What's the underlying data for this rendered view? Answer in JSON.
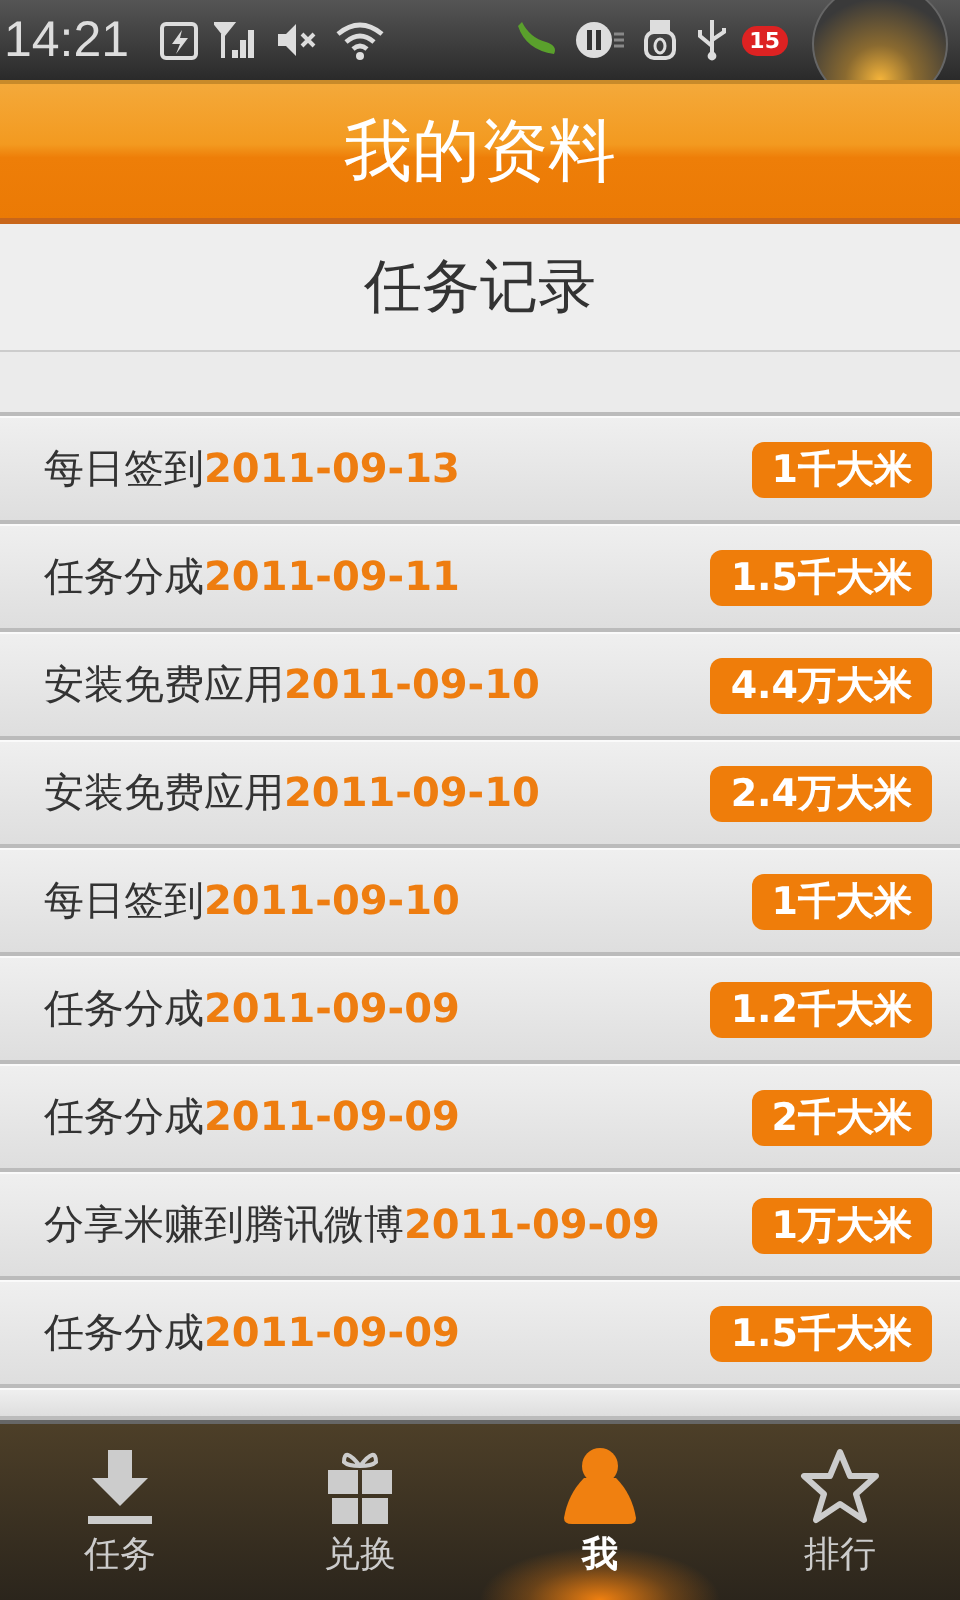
{
  "status_bar": {
    "time": "14:21",
    "notification_count": "15"
  },
  "header": {
    "title": "我的资料"
  },
  "section_title": "任务记录",
  "records": [
    {
      "text": "每日签到**2011-09-13**",
      "reward": "1千大米"
    },
    {
      "text": "任务分成**2011-09-11**",
      "reward": "1.5千大米"
    },
    {
      "text": "安装免费应用**2011-09-10**",
      "reward": "4.4万大米"
    },
    {
      "text": "安装免费应用**2011-09-10**",
      "reward": "2.4万大米"
    },
    {
      "text": "每日签到**2011-09-10**",
      "reward": "1千大米"
    },
    {
      "text": "任务分成**2011-09-09**",
      "reward": "1.2千大米"
    },
    {
      "text": "任务分成**2011-09-09**",
      "reward": "2千大米"
    },
    {
      "text": "分享米赚到腾讯微博**2011-09-09**",
      "reward": "1万大米"
    },
    {
      "text": "任务分成**2011-09-09**",
      "reward": "1.5千大米"
    }
  ],
  "tabs": [
    {
      "label": "任务",
      "kind": "download",
      "selected": false
    },
    {
      "label": "兑换",
      "kind": "gift",
      "selected": false
    },
    {
      "label": "我",
      "kind": "person",
      "selected": true
    },
    {
      "label": "排行",
      "kind": "star",
      "selected": false
    }
  ]
}
